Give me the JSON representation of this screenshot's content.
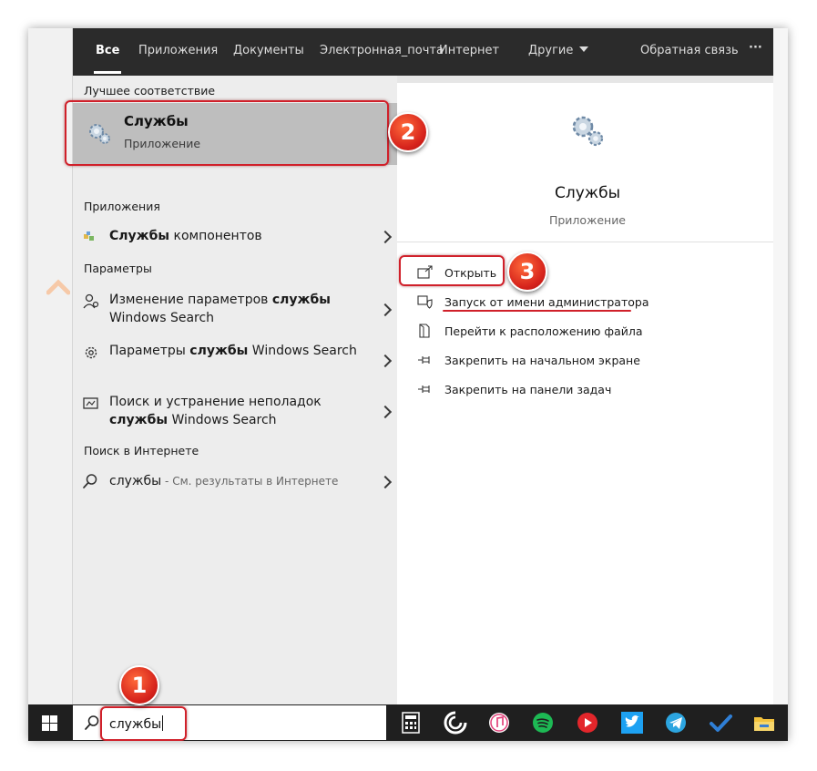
{
  "tabs": [
    {
      "label": "Все",
      "active": true
    },
    {
      "label": "Приложения"
    },
    {
      "label": "Документы"
    },
    {
      "label": "Электронная_почта"
    },
    {
      "label": "Интернет"
    },
    {
      "label": "Другие"
    }
  ],
  "feedback": "Обратная связь",
  "more": "···",
  "best_match": {
    "header": "Лучшее соответствие",
    "title": "Службы",
    "subtitle": "Приложение"
  },
  "apps": {
    "header": "Приложения",
    "item": {
      "bold": "Службы",
      "rest": " компонентов"
    }
  },
  "settings": {
    "header": "Параметры",
    "items": [
      {
        "pre": "Изменение параметров ",
        "bold": "службы",
        "post": " Windows Search"
      },
      {
        "pre": "Параметры ",
        "bold": "службы",
        "post": " Windows Search"
      },
      {
        "pre": "Поиск и устранение неполадок ",
        "bold": "службы",
        "post": " Windows Search"
      }
    ]
  },
  "web": {
    "header": "Поиск в Интернете",
    "query": "службы",
    "suffix": " - См. результаты в Интернете"
  },
  "preview": {
    "title": "Службы",
    "subtitle": "Приложение",
    "actions": [
      {
        "label": "Открыть",
        "icon": "open-icon"
      },
      {
        "label": "Запуск от имени администратора",
        "icon": "shield-icon"
      },
      {
        "label": "Перейти к расположению файла",
        "icon": "file-location-icon"
      },
      {
        "label": "Закрепить на начальном экране",
        "icon": "pin-icon"
      },
      {
        "label": "Закрепить на панели задач",
        "icon": "pin-icon"
      }
    ]
  },
  "search": {
    "value": "службы"
  },
  "badges": [
    "1",
    "2",
    "3"
  ],
  "colors": {
    "accent_red": "#d0202a",
    "topbar": "#2b2b2b",
    "taskbar": "#1f1f1f"
  }
}
